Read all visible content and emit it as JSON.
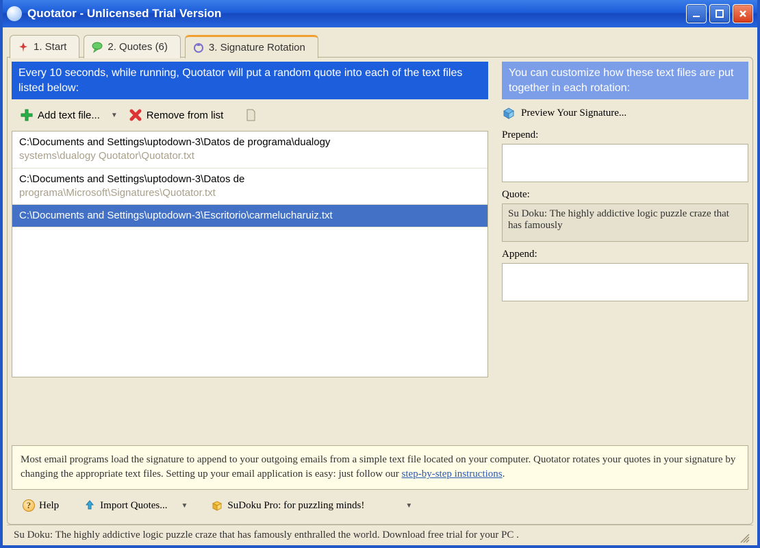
{
  "window": {
    "title": "Quotator - Unlicensed Trial Version"
  },
  "tabs": [
    {
      "label": "1. Start"
    },
    {
      "label": "2. Quotes (6)"
    },
    {
      "label": "3. Signature Rotation"
    }
  ],
  "left": {
    "banner": "Every 10 seconds, while running, Quotator will put a random quote into each of the text files listed below:",
    "toolbar": {
      "add": "Add text file...",
      "remove": "Remove from list"
    },
    "files": [
      {
        "line1": "C:\\Documents and Settings\\uptodown-3\\Datos de programa\\dualogy",
        "line2": "systems\\dualogy Quotator\\Quotator.txt",
        "selected": false
      },
      {
        "line1": "C:\\Documents and Settings\\uptodown-3\\Datos de",
        "line2": "programa\\Microsoft\\Signatures\\Quotator.txt",
        "selected": false
      },
      {
        "line1": "C:\\Documents  and  Settings\\uptodown-3\\Escritorio\\carmelucharuiz.txt",
        "line2": "",
        "selected": true
      }
    ]
  },
  "right": {
    "banner": "You can customize how these text files are put together in each rotation:",
    "preview": "Preview Your Signature...",
    "labels": {
      "prepend": "Prepend:",
      "quote": "Quote:",
      "append": "Append:"
    },
    "values": {
      "prepend": "",
      "quote": "Su Doku: The highly addictive logic puzzle craze that has famously",
      "append": ""
    }
  },
  "info": {
    "text_before": "Most email programs load the signature to append to your outgoing emails from a simple text file located on your computer. Quotator rotates your quotes in your signature by changing the appropriate text files. Setting up your email application is easy: just follow our ",
    "link": "step-by-step instructions",
    "text_after": "."
  },
  "footer": {
    "help": "Help",
    "import": "Import Quotes...",
    "promo": "SuDoku Pro: for puzzling minds!"
  },
  "statusbar": "Su Doku: The highly addictive logic puzzle craze that has famously enthralled the world. Download free trial for your PC ."
}
